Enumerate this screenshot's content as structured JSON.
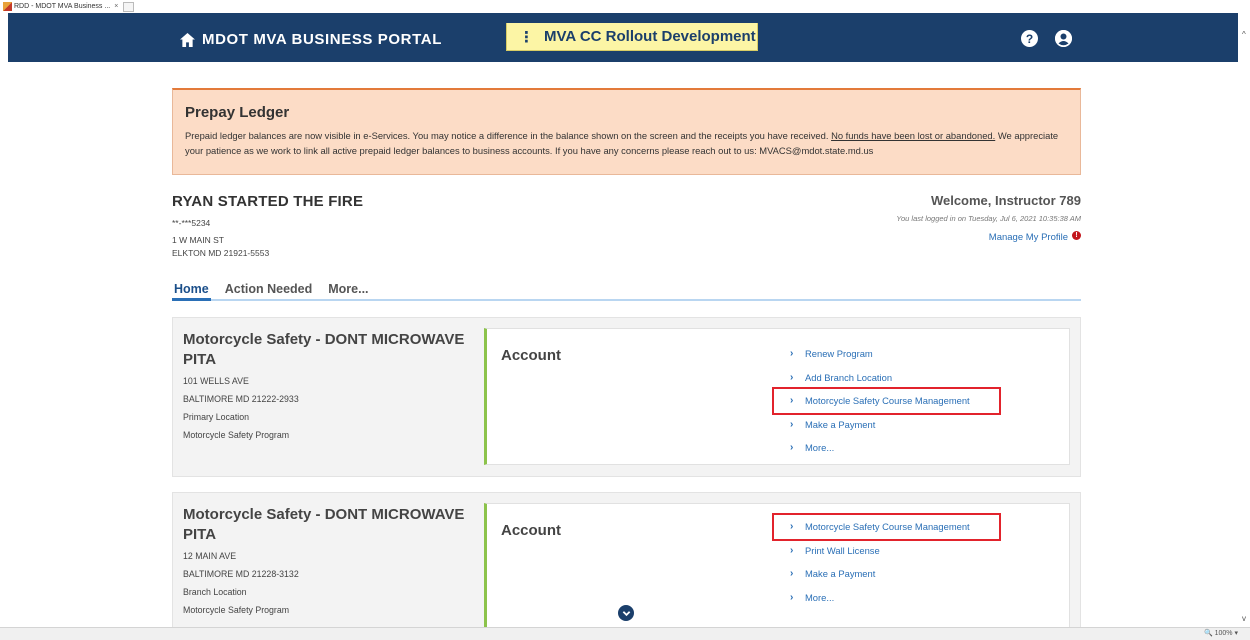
{
  "browser": {
    "tab_title": "RDD - MDOT MVA Business ...",
    "tab_close": "×"
  },
  "navbar": {
    "brand": "MDOT MVA BUSINESS PORTAL",
    "env_banner_dots": "⋮",
    "env_banner": "MVA CC Rollout Development",
    "help_glyph": "?",
    "color": "#1b3f6b"
  },
  "alert": {
    "title": "Prepay Ledger",
    "body_pre": "Prepaid ledger balances are now visible in e-Services. You may notice a difference in the balance shown on the screen and the receipts you have received. ",
    "body_underlined": "No funds have been lost or abandoned.",
    "body_post": " We appreciate your patience as we work to link all active prepaid ledger balances to business accounts. If you have any concerns please reach out to us: MVACS@mdot.state.md.us"
  },
  "business": {
    "name": "RYAN STARTED THE FIRE",
    "masked_id": "**-***5234",
    "address1": "1 W MAIN ST",
    "address2": "ELKTON MD 21921-5553"
  },
  "user": {
    "welcome": "Welcome, Instructor 789",
    "last_login": "You last logged in on Tuesday, Jul 6, 2021 10:35:38 AM",
    "manage_profile": "Manage My Profile",
    "alert_count": "!"
  },
  "tabs": [
    {
      "label": "Home",
      "active": true
    },
    {
      "label": "Action Needed",
      "active": false
    },
    {
      "label": "More...",
      "active": false
    }
  ],
  "cards": [
    {
      "name_line1": "Motorcycle Safety - DONT MICROWAVE",
      "name_line2": "PITA",
      "address1": "101 WELLS AVE",
      "address2": "BALTIMORE MD 21222-2933",
      "location_type": "Primary Location",
      "program": "Motorcycle Safety Program",
      "account_title": "Account",
      "links": [
        {
          "label": "Renew Program"
        },
        {
          "label": "Add Branch Location"
        },
        {
          "label": "Motorcycle Safety Course Management",
          "highlighted": true
        },
        {
          "label": "Make a Payment"
        },
        {
          "label": "More..."
        }
      ]
    },
    {
      "name_line1": "Motorcycle Safety - DONT MICROWAVE",
      "name_line2": "PITA",
      "address1": "12 MAIN AVE",
      "address2": "BALTIMORE MD 21228-3132",
      "location_type": "Branch Location",
      "program": "Motorcycle Safety Program",
      "account_title": "Account",
      "links": [
        {
          "label": "Motorcycle Safety Course Management",
          "highlighted": true
        },
        {
          "label": "Print Wall License"
        },
        {
          "label": "Make a Payment"
        },
        {
          "label": "More..."
        }
      ]
    }
  ],
  "status": {
    "zoom": "🔍 100%  ▾"
  }
}
